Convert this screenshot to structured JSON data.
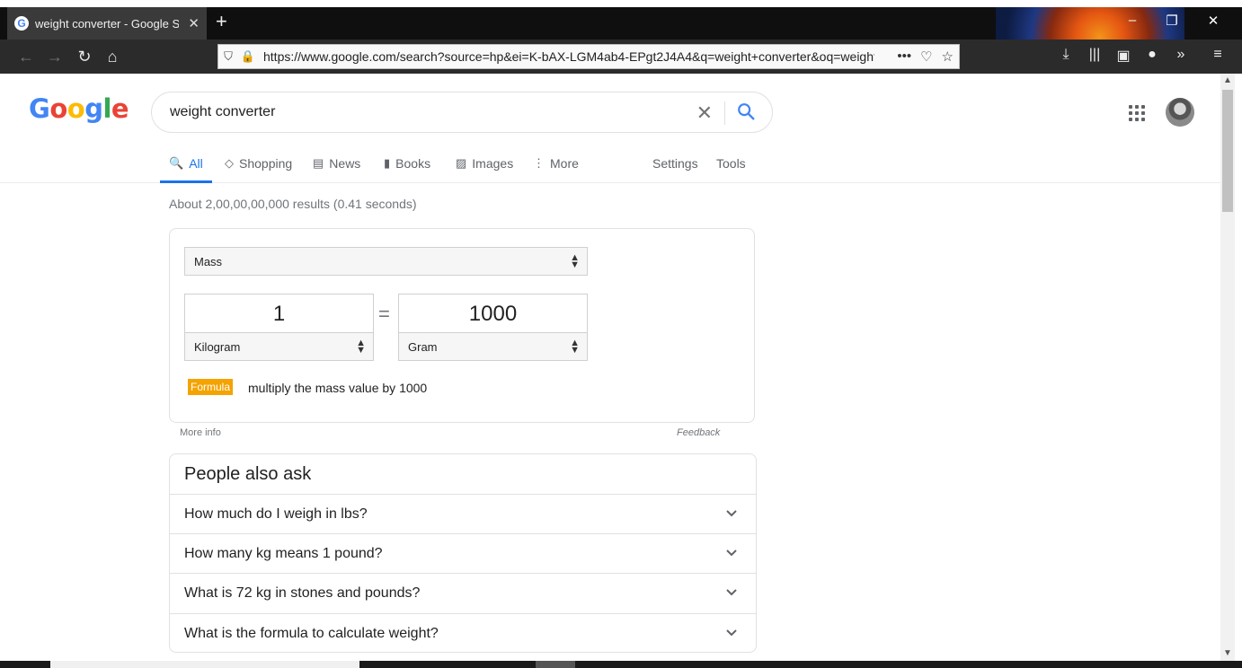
{
  "browser": {
    "tab_title": "weight converter - Google Search",
    "tab_close": "✕",
    "new_tab": "+",
    "minimize": "–",
    "restore": "❐",
    "close": "✕",
    "url": "https://www.google.com/search?source=hp&ei=K-bAX-LGM4ab4-EPgt2J4A4&q=weight+converter&oq=weight+converter",
    "back_icon": "←",
    "forward_icon": "→",
    "reload_icon": "↻",
    "home_icon": "⌂",
    "shield_icon": "⛉",
    "lock_icon": "🔒",
    "more_icon": "•••",
    "pocket_icon": "♡",
    "bookmark_icon": "☆",
    "download_icon": "⤓",
    "library_icon": "|||",
    "sidebar_icon": "▣",
    "account_icon": "●",
    "overflow_icon": "»",
    "menu_icon": "≡"
  },
  "search": {
    "query": "weight converter",
    "clear_icon": "✕"
  },
  "nav_tabs": [
    {
      "label": "All",
      "icon": "🔍"
    },
    {
      "label": "Shopping",
      "icon": "◇"
    },
    {
      "label": "News",
      "icon": "▤"
    },
    {
      "label": "Books",
      "icon": "▮"
    },
    {
      "label": "Images",
      "icon": "▨"
    },
    {
      "label": "More",
      "icon": "⋮"
    }
  ],
  "settings_label": "Settings",
  "tools_label": "Tools",
  "results_count": "About 2,00,00,00,000 results (0.41 seconds)",
  "converter": {
    "quantity": "Mass",
    "from_value": "1",
    "to_value": "1000",
    "from_unit": "Kilogram",
    "to_unit": "Gram",
    "equals": "=",
    "formula_badge": "Formula",
    "formula_text": "multiply the mass value by 1000",
    "more_info": "More info",
    "feedback": "Feedback"
  },
  "people_also_ask": {
    "title": "People also ask",
    "questions": [
      "How much do I weigh in lbs?",
      "How many kg means 1 pound?",
      "What is 72 kg in stones and pounds?",
      "What is the formula to calculate weight?"
    ]
  },
  "colors": {
    "google_blue": "#4285f4",
    "google_red": "#ea4335",
    "google_yellow": "#fbbc05",
    "google_green": "#34a853",
    "link_blue": "#1a73e8",
    "formula_orange": "#f4a300"
  }
}
